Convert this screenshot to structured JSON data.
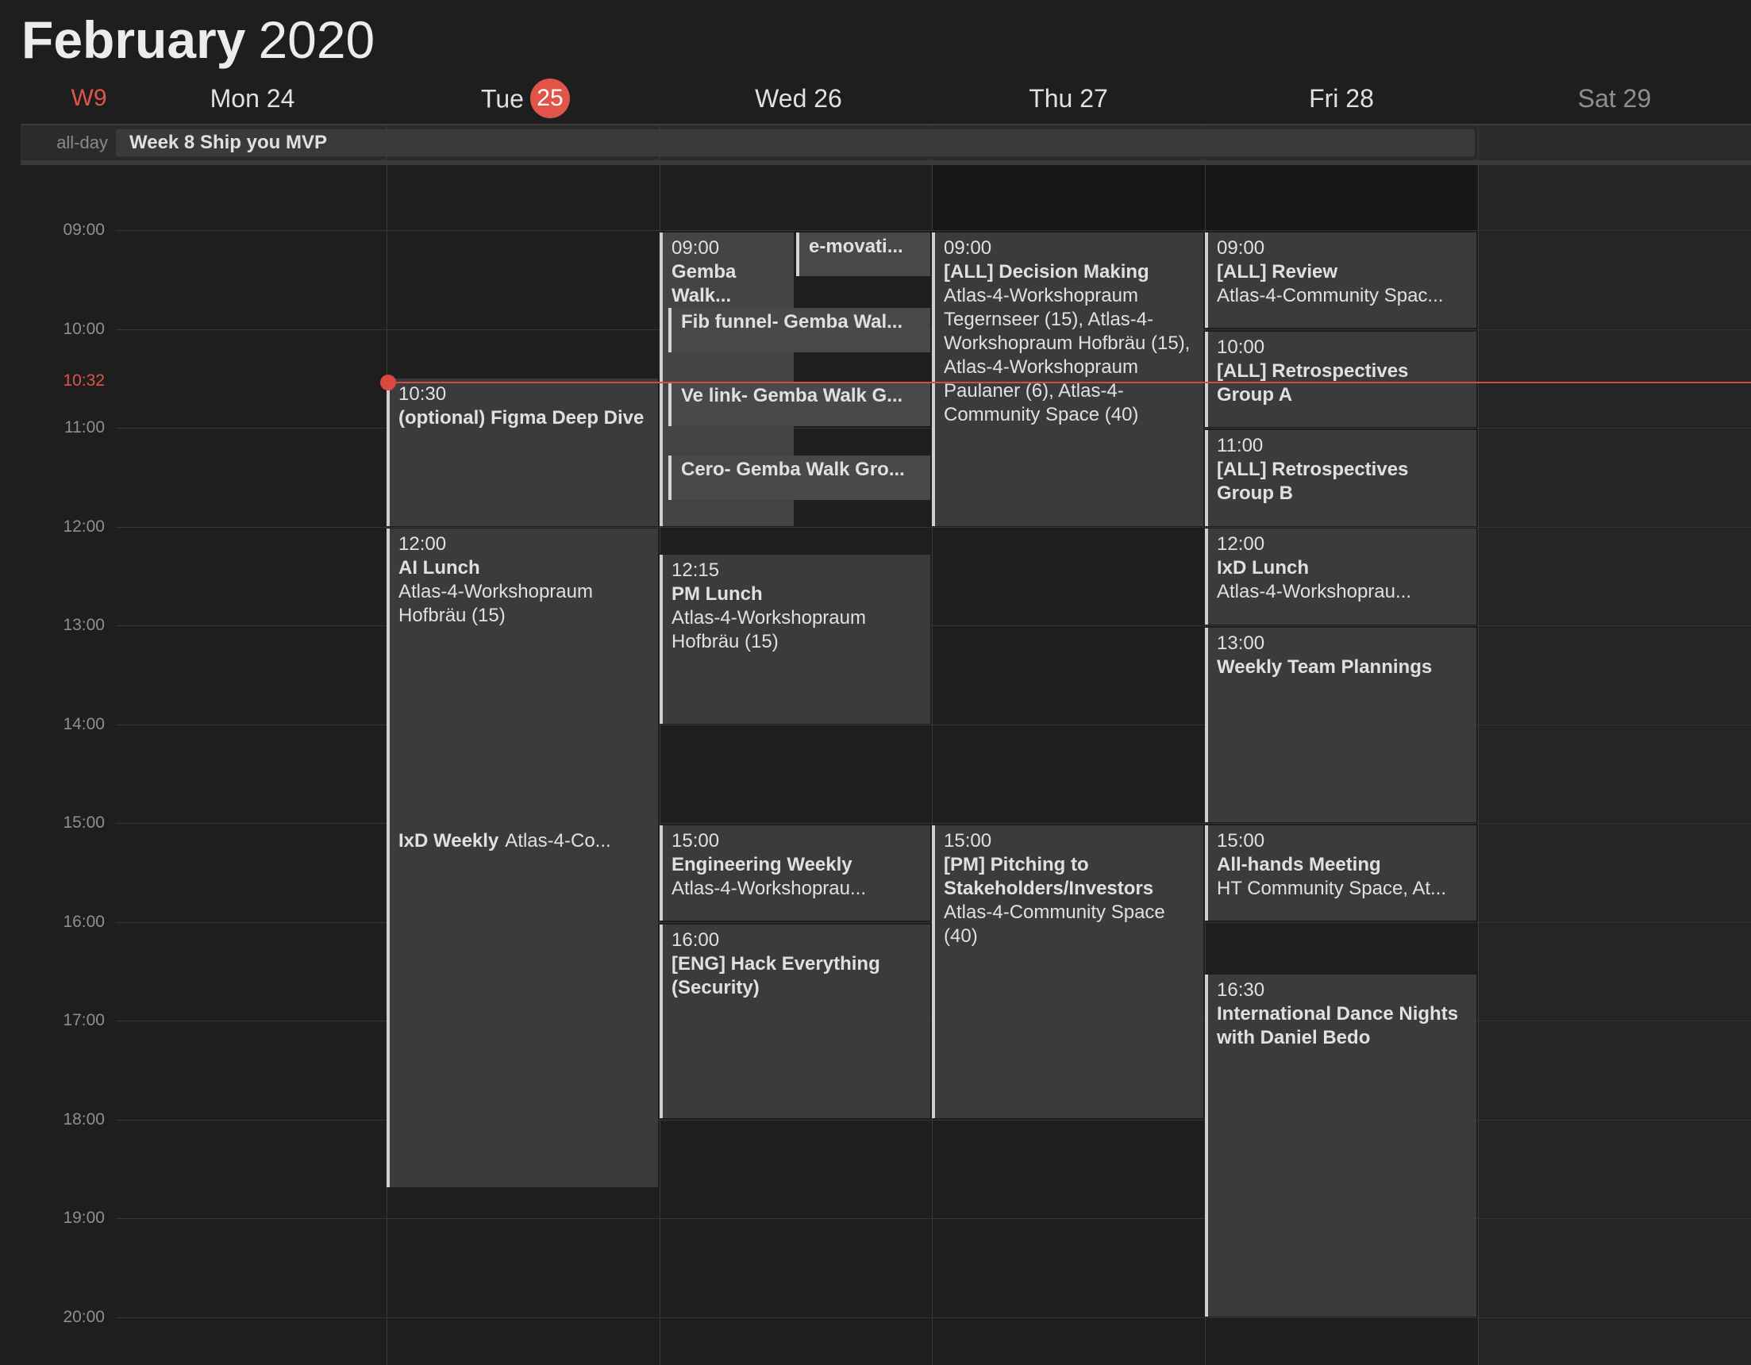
{
  "header": {
    "month": "February",
    "year": "2020",
    "week": "W9",
    "days": [
      {
        "label": "Mon 24"
      },
      {
        "label": "Tue",
        "num": "25"
      },
      {
        "label": "Wed 26"
      },
      {
        "label": "Thu 27"
      },
      {
        "label": "Fri 28"
      },
      {
        "label": "Sat 29"
      }
    ],
    "today_color": "#e0544a"
  },
  "allday": {
    "label": "all-day",
    "event": "Week 8 Ship you MVP"
  },
  "hours": [
    "09:00",
    "10:00",
    "11:00",
    "12:00",
    "13:00",
    "14:00",
    "15:00",
    "16:00",
    "17:00",
    "18:00",
    "19:00",
    "20:00"
  ],
  "now": "10:32",
  "events": {
    "mon": [],
    "tue": [
      {
        "time": "10:30",
        "name": "(optional) Figma Deep Dive"
      },
      {
        "time": "12:00",
        "name": "AI Lunch",
        "location": "Atlas-4-Workshopraum Hofbräu (15)"
      },
      {
        "name": "IxD Weekly",
        "location": "Atlas-4-Co..."
      }
    ],
    "wed": [
      {
        "time": "09:00",
        "name": "Gemba Walk..."
      },
      {
        "name": "e-movati..."
      },
      {
        "name": "Fib funnel- Gemba Wal..."
      },
      {
        "name": "Ve link- Gemba Walk G..."
      },
      {
        "name": "Cero- Gemba Walk Gro..."
      },
      {
        "time": "12:15",
        "name": "PM Lunch",
        "location": "Atlas-4-Workshopraum Hofbräu (15)"
      },
      {
        "time": "15:00",
        "name": "Engineering Weekly",
        "location": "Atlas-4-Workshoprau..."
      },
      {
        "time": "16:00",
        "name": "[ENG] Hack Everything (Security)"
      }
    ],
    "thu": [
      {
        "time": "09:00",
        "name": "[ALL] Decision Making",
        "location": "Atlas-4-Workshopraum Tegernseer (15), Atlas-4-Workshopraum Hofbräu (15), Atlas-4-Workshopraum Paulaner (6), Atlas-4-Community Space (40)"
      },
      {
        "time": "15:00",
        "name": "[PM] Pitching to Stakeholders/Investors",
        "location": "Atlas-4-Community Space (40)"
      }
    ],
    "fri": [
      {
        "time": "09:00",
        "name": "[ALL] Review",
        "location": "Atlas-4-Community Spac..."
      },
      {
        "time": "10:00",
        "name": "[ALL] Retrospectives Group A"
      },
      {
        "time": "11:00",
        "name": "[ALL] Retrospectives Group B"
      },
      {
        "time": "12:00",
        "name": "IxD Lunch",
        "location": "Atlas-4-Workshoprau..."
      },
      {
        "time": "13:00",
        "name": "Weekly Team Plannings"
      },
      {
        "time": "15:00",
        "name": "All-hands Meeting",
        "location": "HT Community Space, At..."
      },
      {
        "time": "16:30",
        "name": "International Dance Nights with Daniel Bedo"
      }
    ]
  }
}
